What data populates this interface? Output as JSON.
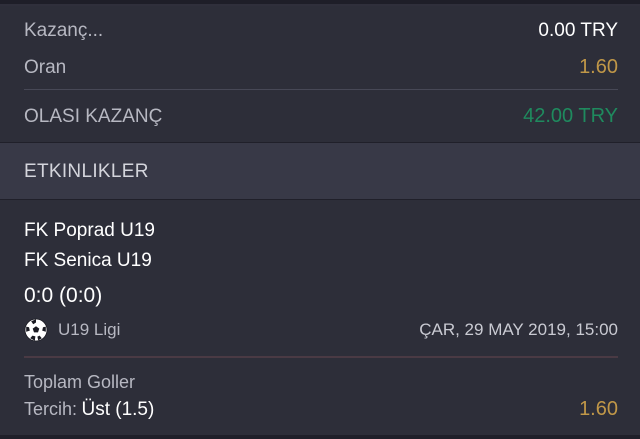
{
  "summary": {
    "winnings_label": "Kazanç...",
    "winnings_value": "0.00 TRY",
    "odds_label": "Oran",
    "odds_value": "1.60",
    "potential_label": "OLASI KAZANÇ",
    "potential_value": "42.00 TRY"
  },
  "events_section": {
    "title": "ETKINLIKLER"
  },
  "event": {
    "home_team": "FK Poprad U19",
    "away_team": "FK Senica U19",
    "score": "0:0 (0:0)",
    "sport_icon": "soccer-ball-icon",
    "league": "U19 Ligi",
    "datetime": "ÇAR, 29 MAY 2019, 15:00",
    "market": "Toplam Goller",
    "pick_label": "Tercih:",
    "pick_value": "Üst (1.5)",
    "pick_odds": "1.60"
  },
  "colors": {
    "background": "#2d2e39",
    "header_bg": "#383947",
    "gold": "#c09748",
    "green": "#1f8a5e"
  }
}
